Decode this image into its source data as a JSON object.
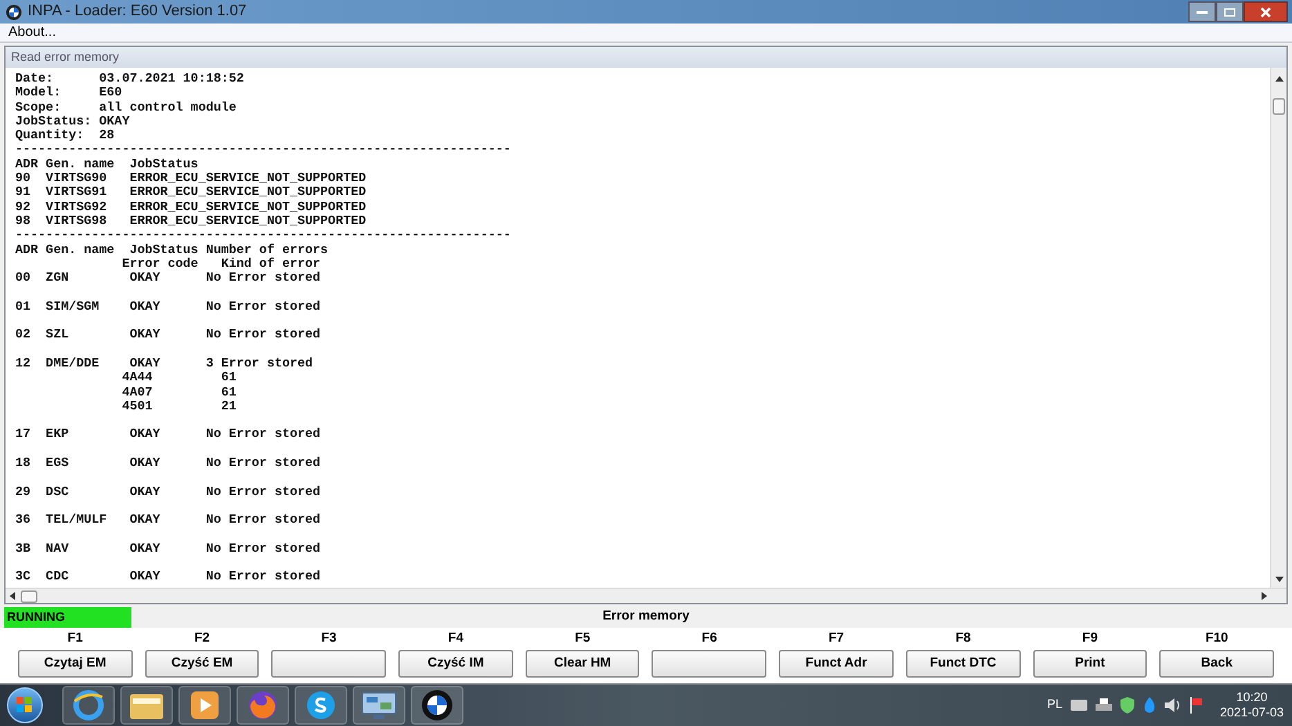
{
  "window": {
    "title": "INPA - Loader:  E60 Version 1.07"
  },
  "menu": [
    "About..."
  ],
  "panel": {
    "title": "Read error memory",
    "blocks": [
      [
        "Date:      03.07.2021 10:18:52",
        "Model:     E60",
        "Scope:     all control module",
        "JobStatus: OKAY",
        "Quantity:  28",
        "-----------------------------------------------------------------",
        "ADR Gen. name  JobStatus",
        "90  VIRTSG90   ERROR_ECU_SERVICE_NOT_SUPPORTED",
        "91  VIRTSG91   ERROR_ECU_SERVICE_NOT_SUPPORTED",
        "92  VIRTSG92   ERROR_ECU_SERVICE_NOT_SUPPORTED",
        "98  VIRTSG98   ERROR_ECU_SERVICE_NOT_SUPPORTED",
        "-----------------------------------------------------------------",
        "ADR Gen. name  JobStatus Number of errors",
        "              Error code   Kind of error",
        "00  ZGN        OKAY      No Error stored"
      ],
      [
        "01  SIM/SGM    OKAY      No Error stored"
      ],
      [
        "02  SZL        OKAY      No Error stored"
      ],
      [
        "12  DME/DDE    OKAY      3 Error stored",
        "              4A44         61",
        "              4A07         61",
        "              4501         21"
      ],
      [
        "17  EKP        OKAY      No Error stored"
      ],
      [
        "18  EGS        OKAY      No Error stored"
      ],
      [
        "29  DSC        OKAY      No Error stored"
      ],
      [
        "36  TEL/MULF   OKAY      No Error stored"
      ],
      [
        "3B  NAV        OKAY      No Error stored"
      ],
      [
        "3C  CDC        OKAY      No Error stored"
      ]
    ]
  },
  "status_bar": {
    "state": "RUNNING",
    "title": "Error memory"
  },
  "function_keys": [
    {
      "key": "F1",
      "label": "Czytaj EM"
    },
    {
      "key": "F2",
      "label": "Czyść EM"
    },
    {
      "key": "F3"
    },
    {
      "key": "F4",
      "label": "Czyść IM"
    },
    {
      "key": "F5",
      "label": "Clear HM"
    },
    {
      "key": "F6"
    },
    {
      "key": "F7",
      "label": "Funct Adr"
    },
    {
      "key": "F8",
      "label": "Funct DTC"
    },
    {
      "key": "F9",
      "label": "Print"
    },
    {
      "key": "F10",
      "label": "Back"
    }
  ],
  "taskbar": {
    "apps": [
      {
        "kind": "browser"
      },
      {
        "kind": "folder"
      },
      {
        "kind": "media"
      },
      {
        "kind": "firefox"
      },
      {
        "kind": "chat"
      },
      {
        "kind": "panel"
      },
      {
        "kind": "roundel"
      }
    ],
    "language": "PL",
    "time": "10:20",
    "date": "2021-07-03"
  }
}
